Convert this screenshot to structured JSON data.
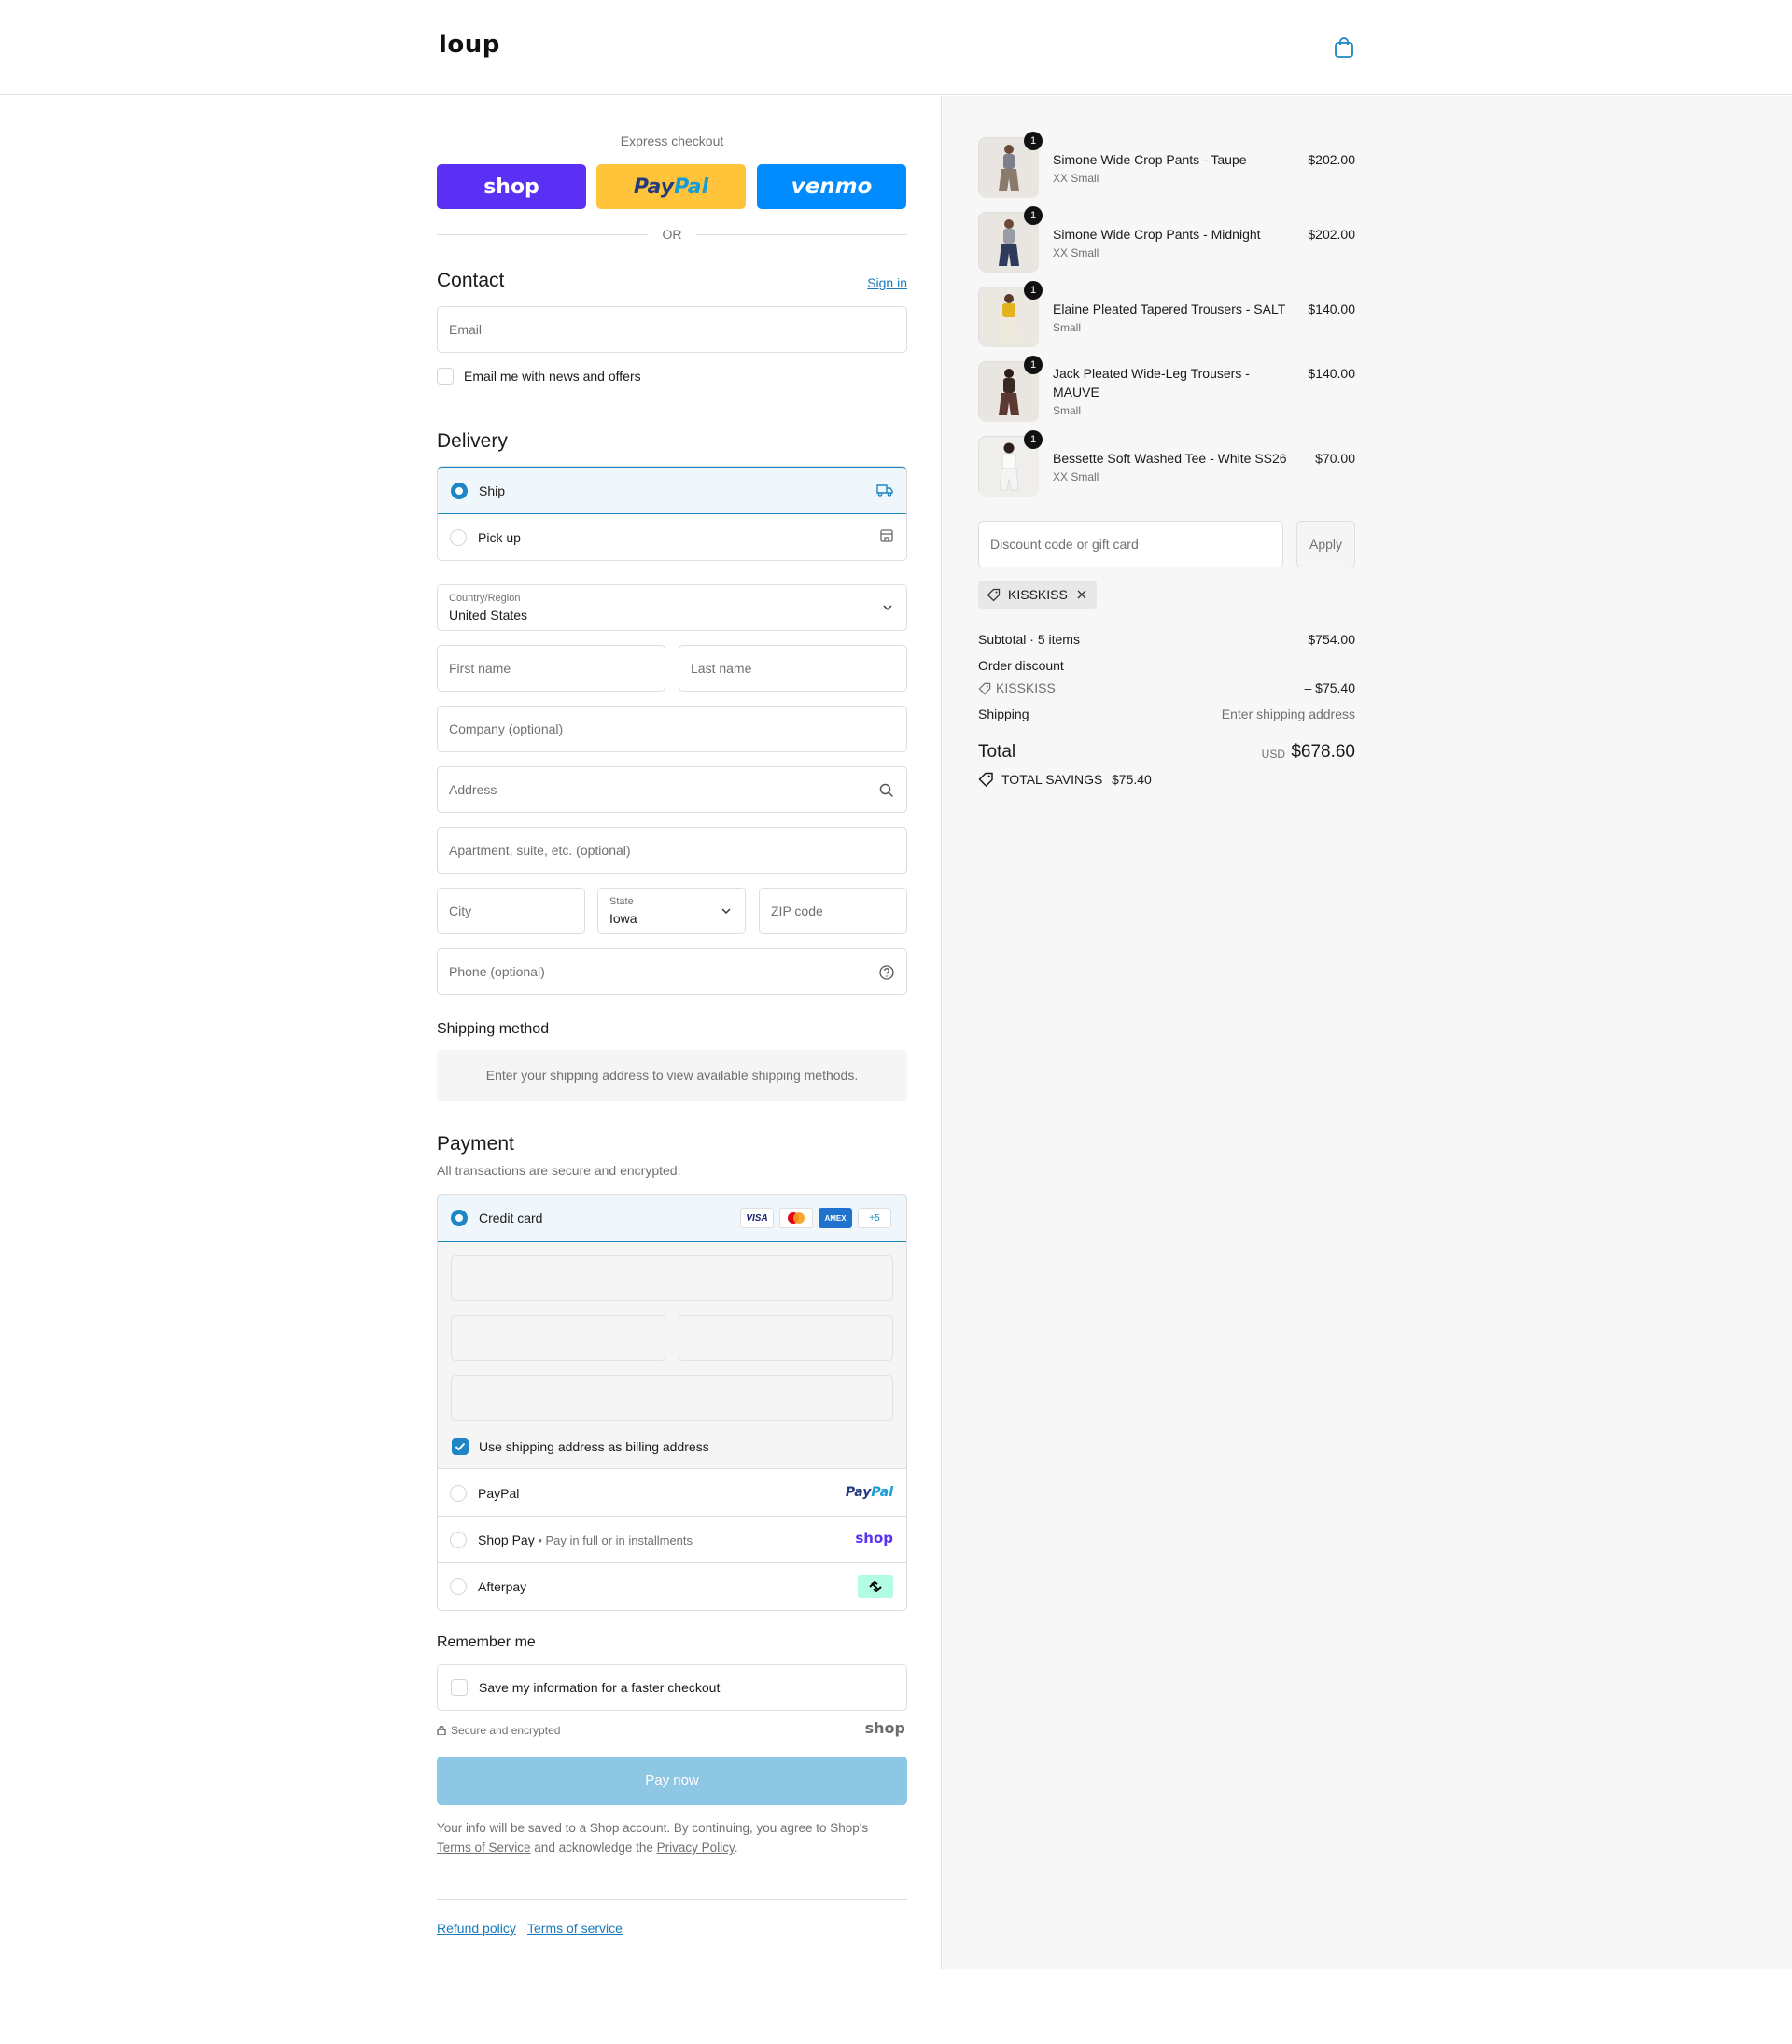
{
  "header": {
    "logo": "loup",
    "cart_icon": "shopping-bag-icon"
  },
  "express": {
    "label": "Express checkout",
    "shop_label": "shop",
    "paypal_label_1": "Pay",
    "paypal_label_2": "Pal",
    "venmo_label": "venmo",
    "or_label": "OR"
  },
  "contact": {
    "title": "Contact",
    "sign_in": "Sign in",
    "email_placeholder": "Email",
    "newsletter_label": "Email me with news and offers"
  },
  "delivery": {
    "title": "Delivery",
    "options": [
      {
        "label": "Ship",
        "icon": "truck-icon",
        "selected": true
      },
      {
        "label": "Pick up",
        "icon": "store-icon",
        "selected": false
      }
    ],
    "country_label": "Country/Region",
    "country_value": "United States",
    "first_name": "First name",
    "last_name": "Last name",
    "company": "Company (optional)",
    "address": "Address",
    "apartment": "Apartment, suite, etc. (optional)",
    "city": "City",
    "state_label": "State",
    "state_value": "Iowa",
    "zip": "ZIP code",
    "phone": "Phone (optional)"
  },
  "shipping_method": {
    "title": "Shipping method",
    "note": "Enter your shipping address to view available shipping methods."
  },
  "payment": {
    "title": "Payment",
    "subtitle": "All transactions are secure and encrypted.",
    "credit_card_label": "Credit card",
    "card_brands": [
      "VISA",
      "mastercard",
      "AMEX",
      "+5"
    ],
    "billing_same_label": "Use shipping address as billing address",
    "paypal_label": "PayPal",
    "paypal_logo_1": "Pay",
    "paypal_logo_2": "Pal",
    "shoppay_label": "Shop Pay",
    "shoppay_sub": "Pay in full or in installments",
    "shoppay_logo": "shop",
    "afterpay_label": "Afterpay"
  },
  "remember": {
    "title": "Remember me",
    "save_label": "Save my information for a faster checkout",
    "secure_label": "Secure and encrypted",
    "shop_logo": "shop"
  },
  "pay_button": "Pay now",
  "legal": {
    "text_1": "Your info will be saved to a Shop account. By continuing, you agree to Shop's",
    "terms": "Terms of Service",
    "text_2": "and acknowledge the",
    "privacy": "Privacy Policy",
    "text_3": "."
  },
  "footer": {
    "refund": "Refund policy",
    "terms": "Terms of service"
  },
  "summary": {
    "items": [
      {
        "name": "Simone Wide Crop Pants - Taupe",
        "variant": "XX Small",
        "price": "$202.00",
        "qty": "1"
      },
      {
        "name": "Simone Wide Crop Pants - Midnight",
        "variant": "XX Small",
        "price": "$202.00",
        "qty": "1"
      },
      {
        "name": "Elaine Pleated Tapered Trousers - SALT",
        "variant": "Small",
        "price": "$140.00",
        "qty": "1"
      },
      {
        "name": "Jack Pleated Wide-Leg Trousers - MAUVE",
        "variant": "Small",
        "price": "$140.00",
        "qty": "1"
      },
      {
        "name": "Bessette Soft Washed Tee - White SS26",
        "variant": "XX Small",
        "price": "$70.00",
        "qty": "1"
      }
    ],
    "discount_placeholder": "Discount code or gift card",
    "apply_label": "Apply",
    "applied_code": "KISSKISS",
    "subtotal_label": "Subtotal · 5 items",
    "subtotal_value": "$754.00",
    "order_discount_label": "Order discount",
    "discount_code": "KISSKISS",
    "discount_value": "– $75.40",
    "shipping_label": "Shipping",
    "shipping_value": "Enter shipping address",
    "total_label": "Total",
    "currency": "USD",
    "total_value": "$678.60",
    "savings_label": "TOTAL SAVINGS",
    "savings_value": "$75.40"
  }
}
